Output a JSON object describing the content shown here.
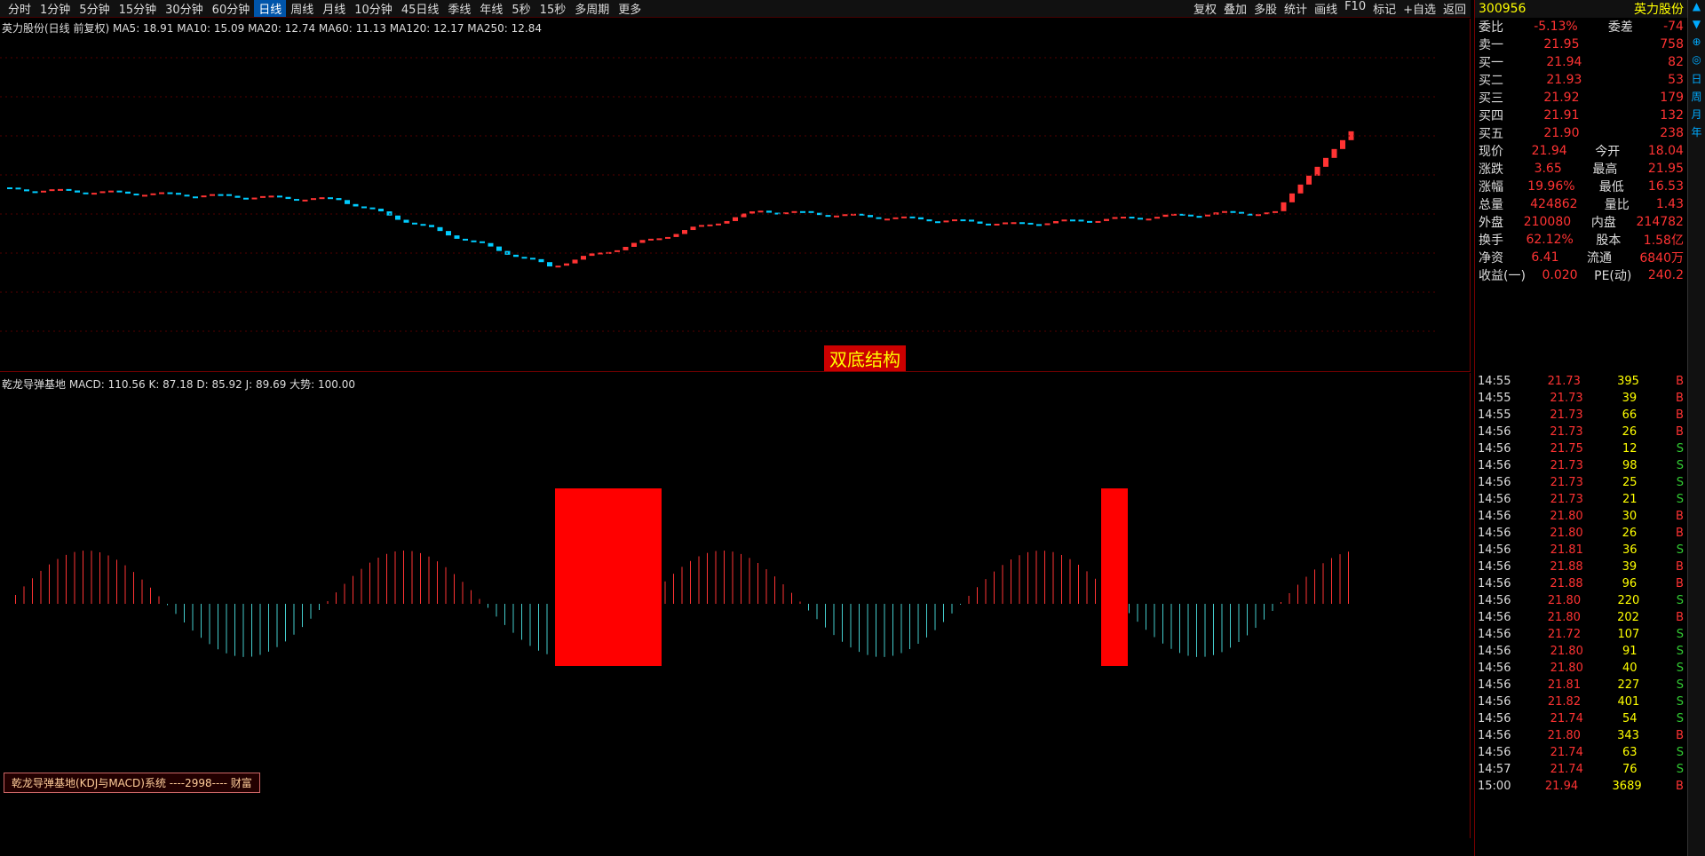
{
  "tabs": [
    "分时",
    "1分钟",
    "5分钟",
    "15分钟",
    "30分钟",
    "60分钟",
    "日线",
    "周线",
    "月线",
    "10分钟",
    "45日线",
    "季线",
    "年线",
    "5秒",
    "15秒",
    "多周期",
    "更多"
  ],
  "right_tabs": [
    "复权",
    "叠加",
    "多股",
    "统计",
    "画线",
    "F10",
    "标记",
    "+自选",
    "返回"
  ],
  "stock": {
    "code": "300956",
    "name": "英力股份"
  },
  "ma_line": "英力股份(日线 前复权)  MA5: 18.91  MA10: 15.09  MA20: 12.74  MA60: 11.13  MA120: 12.17  MA250: 12.84",
  "ind_line": "乾龙导弹基地 MACD: 110.56   K: 87.18  D: 85.92  J: 89.69  大势: 100.00",
  "annot": "双底结构",
  "box": "乾龙导弹基地(KDJ与MACD)系统   ----2998---- 财富",
  "quote": [
    [
      "委比",
      "-5.13%",
      "委差",
      "-74"
    ],
    [
      "卖一",
      "21.95",
      "",
      "758"
    ],
    [
      "买一",
      "21.94",
      "",
      "82"
    ],
    [
      "买二",
      "21.93",
      "",
      "53"
    ],
    [
      "买三",
      "21.92",
      "",
      "179"
    ],
    [
      "买四",
      "21.91",
      "",
      "132"
    ],
    [
      "买五",
      "21.90",
      "",
      "238"
    ],
    [
      "现价",
      "21.94",
      "今开",
      "18.04"
    ],
    [
      "涨跌",
      "3.65",
      "最高",
      "21.95"
    ],
    [
      "涨幅",
      "19.96%",
      "最低",
      "16.53"
    ],
    [
      "总量",
      "424862",
      "量比",
      "1.43"
    ],
    [
      "外盘",
      "210080",
      "内盘",
      "214782"
    ],
    [
      "换手",
      "62.12%",
      "股本",
      "1.58亿"
    ],
    [
      "净资",
      "6.41",
      "流通",
      "6840万"
    ],
    [
      "收益(一)",
      "0.020",
      "PE(动)",
      "240.2"
    ]
  ],
  "ticks": [
    [
      "14:55",
      "21.73",
      "395",
      "B"
    ],
    [
      "14:55",
      "21.73",
      "39",
      "B"
    ],
    [
      "14:55",
      "21.73",
      "66",
      "B"
    ],
    [
      "14:56",
      "21.73",
      "26",
      "B"
    ],
    [
      "14:56",
      "21.75",
      "12",
      "S"
    ],
    [
      "14:56",
      "21.73",
      "98",
      "S"
    ],
    [
      "14:56",
      "21.73",
      "25",
      "S"
    ],
    [
      "14:56",
      "21.73",
      "21",
      "S"
    ],
    [
      "14:56",
      "21.80",
      "30",
      "B"
    ],
    [
      "14:56",
      "21.80",
      "26",
      "B"
    ],
    [
      "14:56",
      "21.81",
      "36",
      "S"
    ],
    [
      "14:56",
      "21.88",
      "39",
      "B"
    ],
    [
      "14:56",
      "21.88",
      "96",
      "B"
    ],
    [
      "14:56",
      "21.80",
      "220",
      "S"
    ],
    [
      "14:56",
      "21.80",
      "202",
      "B"
    ],
    [
      "14:56",
      "21.72",
      "107",
      "S"
    ],
    [
      "14:56",
      "21.80",
      "91",
      "S"
    ],
    [
      "14:56",
      "21.80",
      "40",
      "S"
    ],
    [
      "14:56",
      "21.81",
      "227",
      "S"
    ],
    [
      "14:56",
      "21.82",
      "401",
      "S"
    ],
    [
      "14:56",
      "21.74",
      "54",
      "S"
    ],
    [
      "14:56",
      "21.80",
      "343",
      "B"
    ],
    [
      "14:56",
      "21.74",
      "63",
      "S"
    ],
    [
      "14:57",
      "21.74",
      "76",
      "S"
    ],
    [
      "15:00",
      "21.94",
      "3689",
      "B"
    ]
  ]
}
